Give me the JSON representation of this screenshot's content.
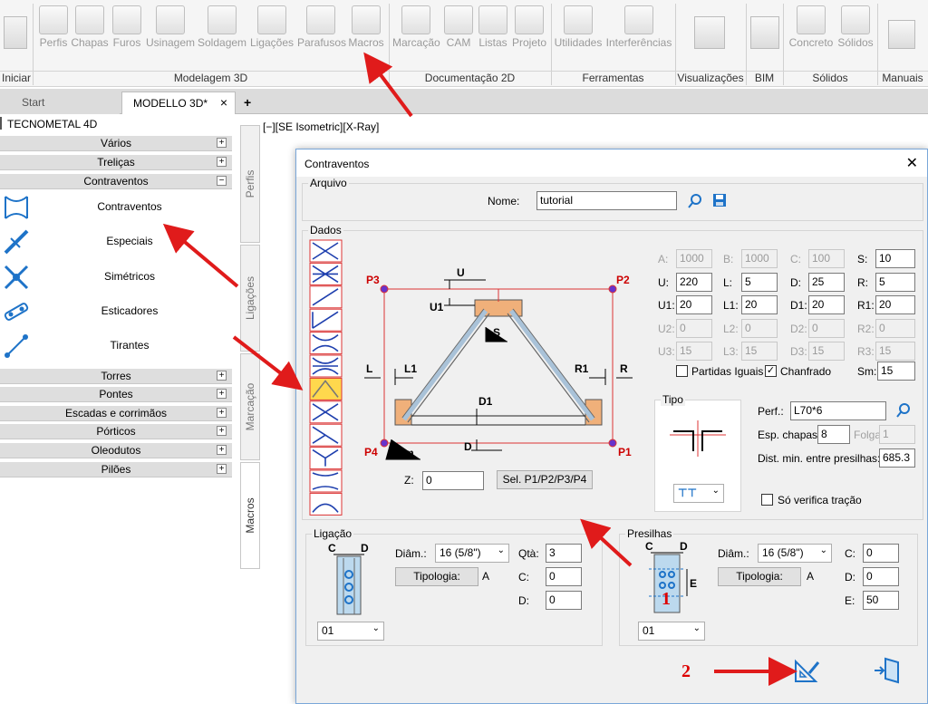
{
  "ribbon": {
    "buttons": [
      {
        "label": "Perfis",
        "icon": "profile-icon"
      },
      {
        "label": "Chapas",
        "icon": "plate-icon"
      },
      {
        "label": "Furos",
        "icon": "drill-icon"
      },
      {
        "label": "Usinagem",
        "icon": "machining-icon"
      },
      {
        "label": "Soldagem",
        "icon": "welding-icon"
      },
      {
        "label": "Ligações",
        "icon": "connection-icon"
      },
      {
        "label": "Parafusos",
        "icon": "bolt-icon"
      },
      {
        "label": "Macros",
        "icon": "macro-icon"
      },
      {
        "label": "Marcação",
        "icon": "tag-icon"
      },
      {
        "label": "CAM",
        "icon": "cam-icon"
      },
      {
        "label": "Listas",
        "icon": "list-icon"
      },
      {
        "label": "Projeto",
        "icon": "project-icon"
      },
      {
        "label": "Utilidades",
        "icon": "funnel-icon"
      },
      {
        "label": "Interferências",
        "icon": "interference-icon"
      },
      {
        "label": "Concreto",
        "icon": "concrete-icon"
      },
      {
        "label": "Sólidos",
        "icon": "solid-icon"
      }
    ],
    "groups": [
      "Iniciar",
      "Modelagem 3D",
      "Documentação 2D",
      "Ferramentas",
      "Visualizações",
      "BIM",
      "Sólidos",
      "Manuais"
    ]
  },
  "tabs": {
    "start": "Start",
    "active": "MODELLO 3D*",
    "close": "×",
    "add": "+"
  },
  "viewport_label": "[−][SE Isometric][X-Ray]",
  "panel": {
    "title": "TECNOMETAL 4D",
    "categories_top": [
      {
        "label": "Vários",
        "sign": "+"
      },
      {
        "label": "Treliças",
        "sign": "+"
      },
      {
        "label": "Contraventos",
        "sign": "−"
      }
    ],
    "subitems": [
      "Contraventos",
      "Especiais",
      "Simétricos",
      "Esticadores",
      "Tirantes"
    ],
    "categories_bottom": [
      {
        "label": "Torres",
        "sign": "+"
      },
      {
        "label": "Pontes",
        "sign": "+"
      },
      {
        "label": "Escadas e corrimãos",
        "sign": "+"
      },
      {
        "label": "Pórticos",
        "sign": "+"
      },
      {
        "label": "Oleodutos",
        "sign": "+"
      },
      {
        "label": "Pilões",
        "sign": "+"
      }
    ],
    "side_tabs": [
      "Perfis",
      "Ligações",
      "Marcação",
      "Macros"
    ]
  },
  "dialog": {
    "title": "Contraventos",
    "close": "✕",
    "arquivo": {
      "legend": "Arquivo",
      "nome_label": "Nome:",
      "nome_value": "tutorial"
    },
    "dados": {
      "legend": "Dados",
      "params": [
        {
          "label": "A:",
          "value": "1000",
          "disabled": true
        },
        {
          "label": "B:",
          "value": "1000",
          "disabled": true
        },
        {
          "label": "C:",
          "value": "100",
          "disabled": true
        },
        {
          "label": "S:",
          "value": "10",
          "disabled": false
        },
        {
          "label": "U:",
          "value": "220",
          "disabled": false
        },
        {
          "label": "L:",
          "value": "5",
          "disabled": false
        },
        {
          "label": "D:",
          "value": "25",
          "disabled": false
        },
        {
          "label": "R:",
          "value": "5",
          "disabled": false
        },
        {
          "label": "U1:",
          "value": "20",
          "disabled": false
        },
        {
          "label": "L1:",
          "value": "20",
          "disabled": false
        },
        {
          "label": "D1:",
          "value": "20",
          "disabled": false
        },
        {
          "label": "R1:",
          "value": "20",
          "disabled": false
        },
        {
          "label": "U2:",
          "value": "0",
          "disabled": true
        },
        {
          "label": "L2:",
          "value": "0",
          "disabled": true
        },
        {
          "label": "D2:",
          "value": "0",
          "disabled": true
        },
        {
          "label": "R2:",
          "value": "0",
          "disabled": true
        },
        {
          "label": "U3:",
          "value": "15",
          "disabled": true
        },
        {
          "label": "L3:",
          "value": "15",
          "disabled": true
        },
        {
          "label": "D3:",
          "value": "15",
          "disabled": true
        },
        {
          "label": "R3:",
          "value": "15",
          "disabled": true
        }
      ],
      "partidas_label": "Partidas Iguais",
      "partidas_checked": false,
      "chanfrado_label": "Chanfrado",
      "chanfrado_checked": true,
      "sm_label": "Sm:",
      "sm_value": "15",
      "z_label": "Z:",
      "z_value": "0",
      "sel_button": "Sel. P1/P2/P3/P4",
      "diagram": {
        "P1": "P1",
        "P2": "P2",
        "P3": "P3",
        "P4": "P4",
        "U": "U",
        "U1": "U1",
        "S": "S",
        "L": "L",
        "L1": "L1",
        "R": "R",
        "R1": "R1",
        "D": "D",
        "D1": "D1",
        "Sm": "Sm"
      },
      "selected_type_index": 6
    },
    "tipo": {
      "legend": "Tipo",
      "perf_label": "Perf.:",
      "perf_value": "L70*6",
      "esp_label": "Esp. chapas:",
      "esp_value": "8",
      "folga_label": "Folga",
      "folga_value": "1",
      "dist_label": "Dist. min. entre presilhas:",
      "dist_value": "685.3",
      "verifica_label": "Só verifica tração",
      "verifica_checked": false
    },
    "ligacao": {
      "legend": "Ligação",
      "diam_label": "Diâm.:",
      "diam_value": "16 (5/8\")",
      "qta_label": "Qtà:",
      "qta_value": "3",
      "c_label": "C:",
      "c_value": "0",
      "d_label": "D:",
      "d_value": "0",
      "tipologia_button": "Tipologia:",
      "tipologia_value": "A",
      "combo_value": "01",
      "fig_c": "C",
      "fig_d": "D"
    },
    "presilhas": {
      "legend": "Presilhas",
      "diam_label": "Diâm.:",
      "diam_value": "16 (5/8\")",
      "c_label": "C:",
      "c_value": "0",
      "d_label": "D:",
      "d_value": "0",
      "e_label": "E:",
      "e_value": "50",
      "tipologia_button": "Tipologia:",
      "tipologia_value": "A",
      "combo_value": "01",
      "fig_c": "C",
      "fig_d": "D",
      "fig_e": "E"
    }
  },
  "annotations": {
    "step1": "1",
    "step2": "2"
  },
  "colors": {
    "accent": "#1e73c8",
    "arrow": "#e01b1b",
    "highlight": "#ffd84d"
  }
}
